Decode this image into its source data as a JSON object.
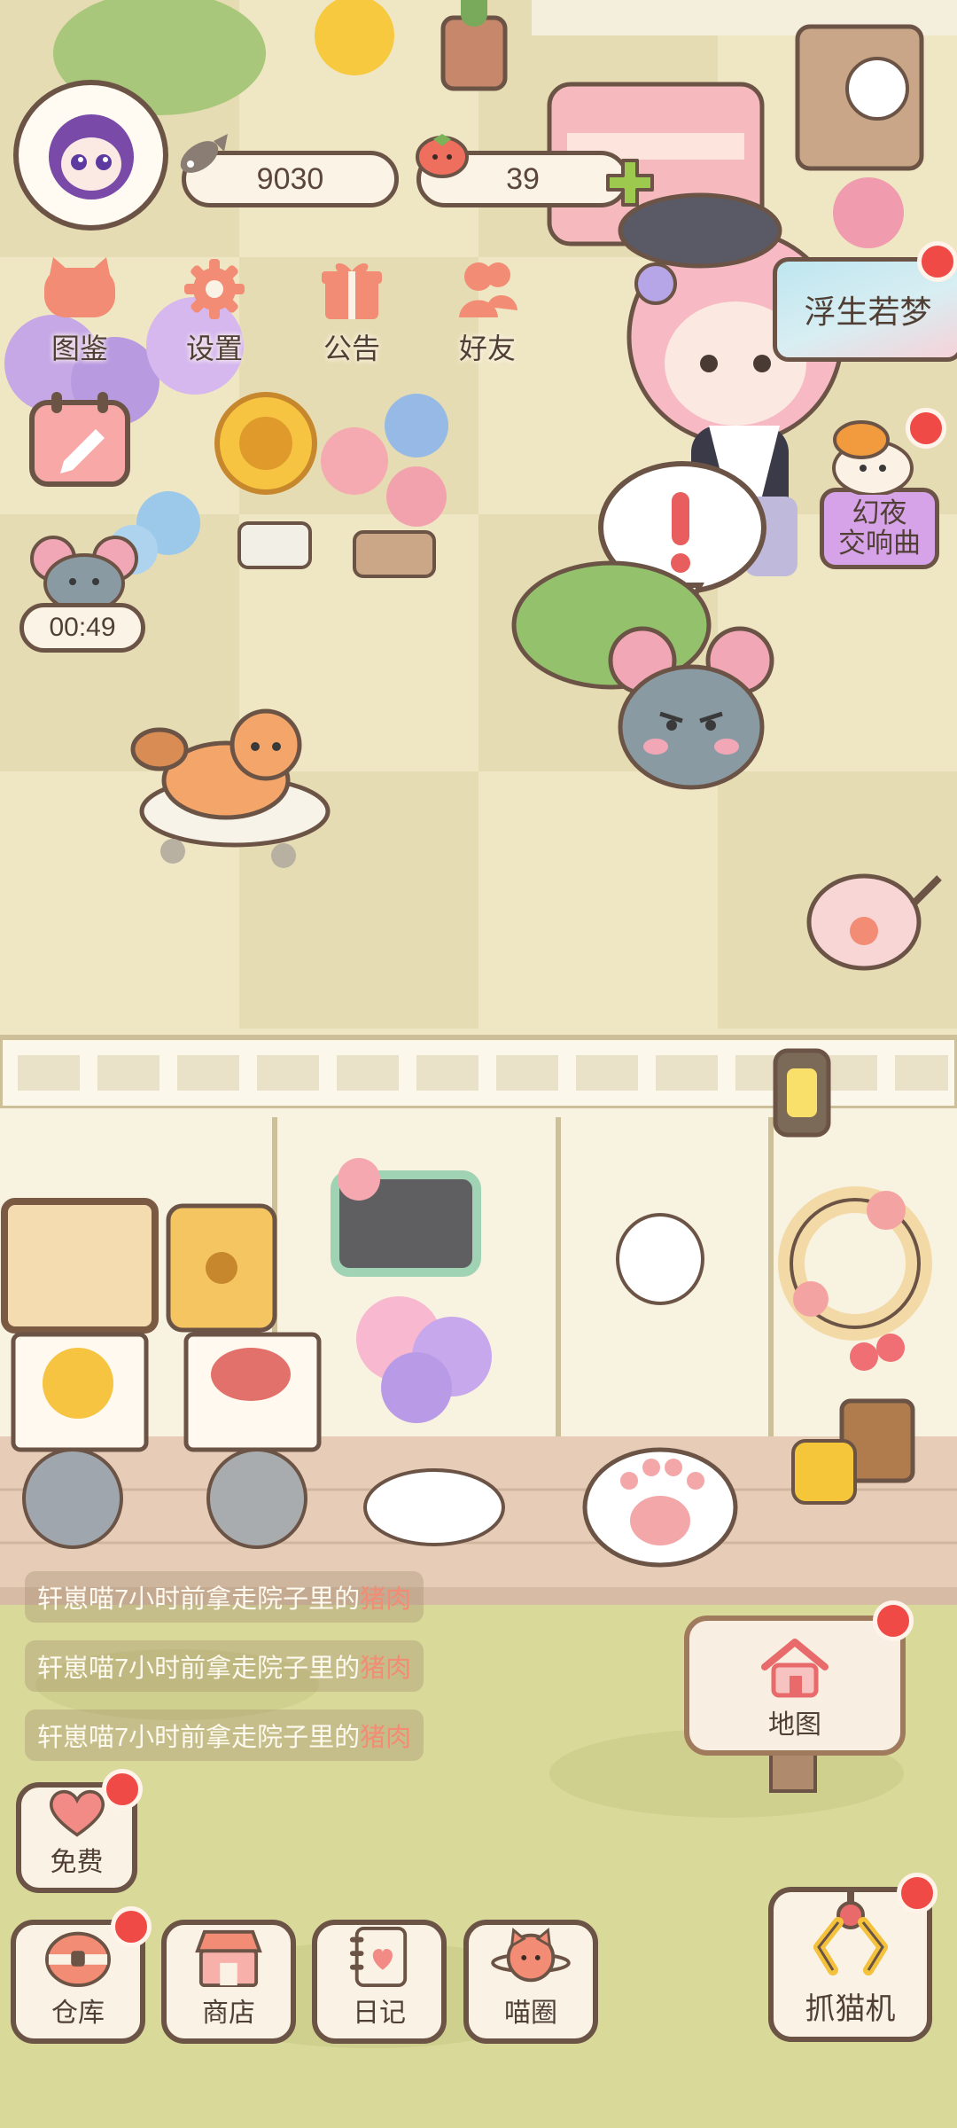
{
  "hud": {
    "fish_count": "9030",
    "tomato_count": "39",
    "timer": "00:49"
  },
  "top_menu": [
    {
      "label": "图鉴",
      "icon": "cat-head-icon"
    },
    {
      "label": "设置",
      "icon": "gear-icon"
    },
    {
      "label": "公告",
      "icon": "gift-icon"
    },
    {
      "label": "好友",
      "icon": "friends-icon"
    }
  ],
  "events": {
    "fusheng": "浮生若梦",
    "huanye_line1": "幻夜",
    "huanye_line2": "交响曲"
  },
  "logs": [
    {
      "prefix": "轩崽喵7小时前拿走院子里的",
      "item": "猪肉"
    },
    {
      "prefix": "轩崽喵7小时前拿走院子里的",
      "item": "猪肉"
    },
    {
      "prefix": "轩崽喵7小时前拿走院子里的",
      "item": "猪肉"
    }
  ],
  "map_label": "地图",
  "free_label": "免费",
  "bottom_bar": [
    {
      "label": "仓库",
      "icon": "warehouse-icon"
    },
    {
      "label": "商店",
      "icon": "shop-icon"
    },
    {
      "label": "日记",
      "icon": "diary-icon"
    },
    {
      "label": "喵圈",
      "icon": "cat-planet-icon"
    }
  ],
  "claw_label": "抓猫机",
  "colors": {
    "badge": "#ef4a46",
    "outline": "#6b5446",
    "accent": "#f28c74"
  }
}
